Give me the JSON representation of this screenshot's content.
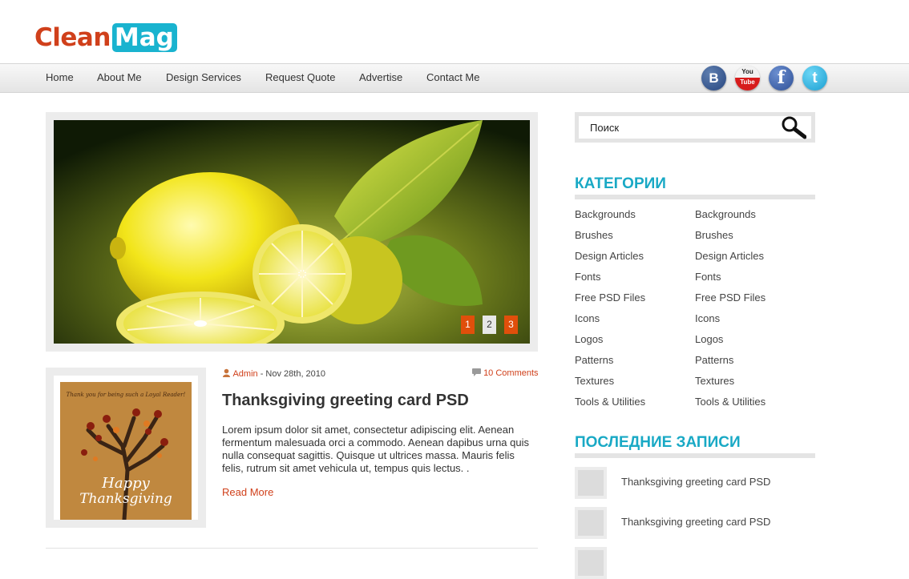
{
  "header": {
    "logo_part1": "Clean",
    "logo_part2": "Mag",
    "nav": [
      "Home",
      "About Me",
      "Design Services",
      "Request Quote",
      "Advertise",
      "Contact Me"
    ],
    "social": {
      "vk": "B",
      "youtube_top": "You",
      "youtube_bottom": "Tube",
      "facebook": "f",
      "twitter": "t"
    }
  },
  "slider": {
    "pages": [
      "1",
      "2",
      "3"
    ],
    "active_pages": [
      "1",
      "3"
    ]
  },
  "post": {
    "author": "Admin",
    "date": " - Nov 28th, 2010",
    "comments": "10 Comments",
    "title": "Thanksgiving greeting card PSD",
    "excerpt": "Lorem ipsum dolor sit amet, consectetur adipiscing elit. Aenean fermentum malesuada orci a commodo. Aenean dapibus urna quis nulla consequat sagittis. Quisque ut ultrices massa. Mauris felis felis, rutrum sit amet vehicula ut, tempus quis lectus. .",
    "read_more": "Read More",
    "card_top_text": "Thank you for being such a Loyal Reader!",
    "card_happy": "Happy",
    "card_thanks": "Thanksgiving"
  },
  "sidebar": {
    "search_placeholder": "Поиск",
    "categories_title": "КАТЕГОРИИ",
    "categories_col1": [
      "Backgrounds",
      "Brushes",
      "Design Articles",
      "Fonts",
      "Free PSD Files",
      "Icons",
      "Logos",
      "Patterns",
      "Textures",
      "Tools & Utilities"
    ],
    "categories_col2": [
      "Backgrounds",
      "Brushes",
      "Design Articles",
      "Fonts",
      "Free PSD Files",
      "Icons",
      "Logos",
      "Patterns",
      "Textures",
      "Tools & Utilities"
    ],
    "recent_title": "ПОСЛЕДНИЕ ЗАПИСИ",
    "recent_posts": [
      "Thanksgiving greeting card PSD",
      "Thanksgiving greeting card PSD"
    ]
  },
  "colors": {
    "accent_orange": "#d0401b",
    "accent_teal": "#19a9c5",
    "pager_active": "#e04f0b"
  }
}
